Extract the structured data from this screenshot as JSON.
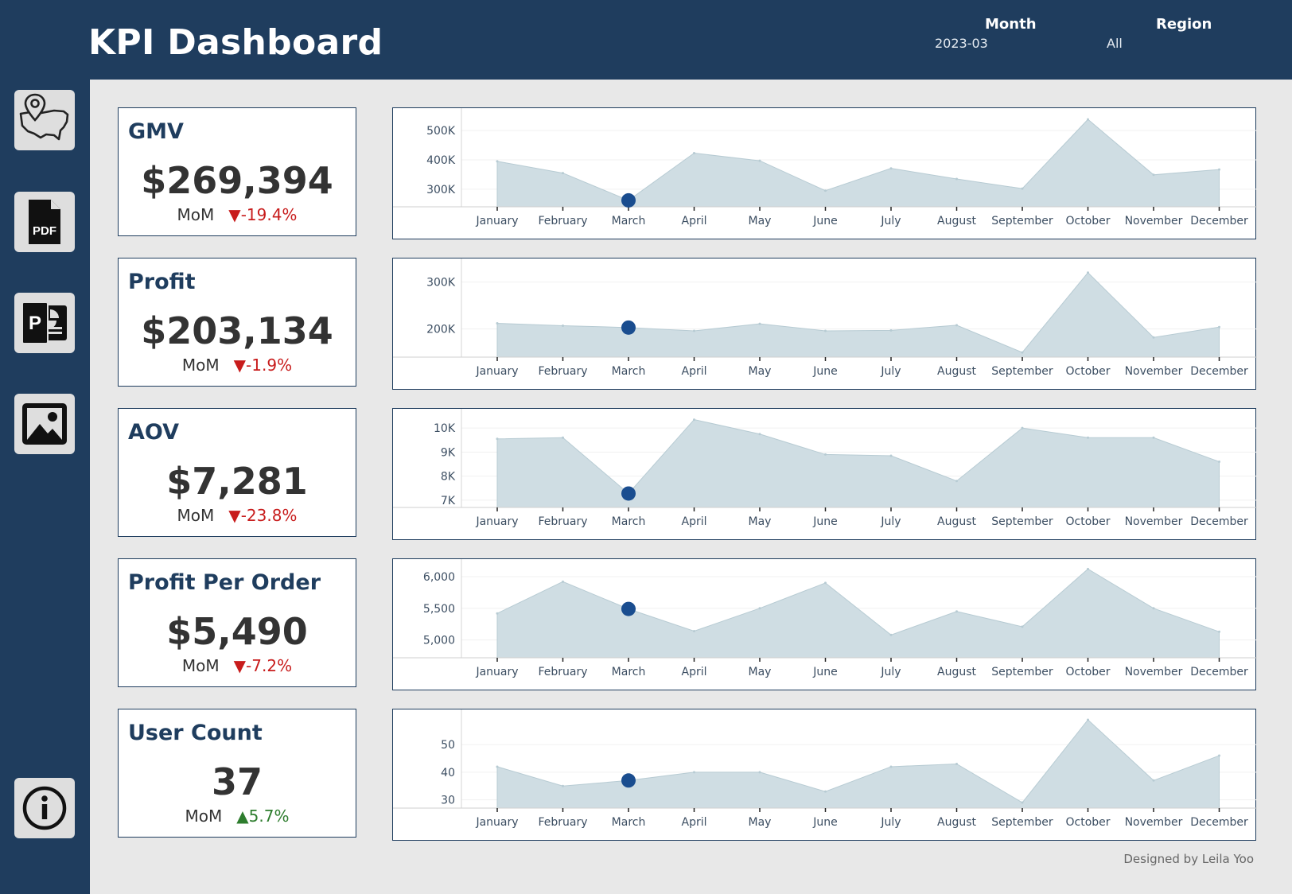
{
  "header": {
    "title": "KPI Dashboard",
    "filters": [
      {
        "label": "Month",
        "value": "2023-03"
      },
      {
        "label": "Region",
        "value": "All"
      }
    ]
  },
  "sidebar": {
    "buttons": [
      {
        "name": "map-button",
        "icon": "us-map-pin-icon"
      },
      {
        "name": "export-pdf-button",
        "icon": "pdf-file-icon",
        "icon_text": "PDF"
      },
      {
        "name": "export-powerpoint-button",
        "icon": "powerpoint-icon",
        "icon_text": "P"
      },
      {
        "name": "export-image-button",
        "icon": "image-icon"
      },
      {
        "name": "info-button",
        "icon": "info-icon"
      }
    ]
  },
  "kpis": [
    {
      "title": "GMV",
      "value": "$269,394",
      "mom_label": "MoM",
      "mom_change": "-19.4%",
      "direction": "down"
    },
    {
      "title": "Profit",
      "value": "$203,134",
      "mom_label": "MoM",
      "mom_change": "-1.9%",
      "direction": "down"
    },
    {
      "title": "AOV",
      "value": "$7,281",
      "mom_label": "MoM",
      "mom_change": "-23.8%",
      "direction": "down"
    },
    {
      "title": "Profit Per Order",
      "value": "$5,490",
      "mom_label": "MoM",
      "mom_change": "-7.2%",
      "direction": "down"
    },
    {
      "title": "User Count",
      "value": "37",
      "mom_label": "MoM",
      "mom_change": "5.7%",
      "direction": "up"
    }
  ],
  "colors": {
    "navy": "#1f3d5e",
    "area_fill": "#cfdde3",
    "area_stroke": "#b7cbd3",
    "highlight": "#1a4d8f",
    "down": "#c81c1c",
    "up": "#2e7d2e"
  },
  "chart_data": [
    {
      "type": "area",
      "metric": "GMV",
      "categories": [
        "January",
        "February",
        "March",
        "April",
        "May",
        "June",
        "July",
        "August",
        "September",
        "October",
        "November",
        "December"
      ],
      "values": [
        395000,
        355000,
        262000,
        423000,
        397000,
        295000,
        371000,
        335000,
        302000,
        538000,
        349000,
        367000
      ],
      "yticks": [
        {
          "v": 300000,
          "label": "300K"
        },
        {
          "v": 400000,
          "label": "400K"
        },
        {
          "v": 500000,
          "label": "500K"
        }
      ],
      "ylim": [
        240000,
        560000
      ],
      "highlight_index": 2
    },
    {
      "type": "area",
      "metric": "Profit",
      "categories": [
        "January",
        "February",
        "March",
        "April",
        "May",
        "June",
        "July",
        "August",
        "September",
        "October",
        "November",
        "December"
      ],
      "values": [
        212000,
        207000,
        203000,
        196000,
        211000,
        196000,
        197000,
        208000,
        150000,
        320000,
        182000,
        204000
      ],
      "yticks": [
        {
          "v": 200000,
          "label": "200K"
        },
        {
          "v": 300000,
          "label": "300K"
        }
      ],
      "ylim": [
        140000,
        340000
      ],
      "highlight_index": 2
    },
    {
      "type": "area",
      "metric": "AOV",
      "categories": [
        "January",
        "February",
        "March",
        "April",
        "May",
        "June",
        "July",
        "August",
        "September",
        "October",
        "November",
        "December"
      ],
      "values": [
        9550,
        9600,
        7280,
        10350,
        9750,
        8900,
        8850,
        7800,
        10000,
        9600,
        9600,
        8600
      ],
      "yticks": [
        {
          "v": 7000,
          "label": "7K"
        },
        {
          "v": 8000,
          "label": "8K"
        },
        {
          "v": 9000,
          "label": "9K"
        },
        {
          "v": 10000,
          "label": "10K"
        }
      ],
      "ylim": [
        6700,
        10600
      ],
      "highlight_index": 2
    },
    {
      "type": "area",
      "metric": "Profit Per Order",
      "categories": [
        "January",
        "February",
        "March",
        "April",
        "May",
        "June",
        "July",
        "August",
        "September",
        "October",
        "November",
        "December"
      ],
      "values": [
        5420,
        5920,
        5490,
        5140,
        5500,
        5900,
        5080,
        5450,
        5210,
        6120,
        5500,
        5130
      ],
      "yticks": [
        {
          "v": 5000,
          "label": "5,000"
        },
        {
          "v": 5500,
          "label": "5,500"
        },
        {
          "v": 6000,
          "label": "6,000"
        }
      ],
      "ylim": [
        4720,
        6200
      ],
      "highlight_index": 2
    },
    {
      "type": "area",
      "metric": "User Count",
      "categories": [
        "January",
        "February",
        "March",
        "April",
        "May",
        "June",
        "July",
        "August",
        "September",
        "October",
        "November",
        "December"
      ],
      "values": [
        42,
        35,
        37,
        40,
        40,
        33,
        42,
        43,
        29,
        59,
        37,
        46
      ],
      "yticks": [
        {
          "v": 30,
          "label": "30"
        },
        {
          "v": 40,
          "label": "40"
        },
        {
          "v": 50,
          "label": "50"
        }
      ],
      "ylim": [
        27,
        61
      ],
      "highlight_index": 2
    }
  ],
  "footer": {
    "credit": "Designed by Leila Yoo"
  }
}
